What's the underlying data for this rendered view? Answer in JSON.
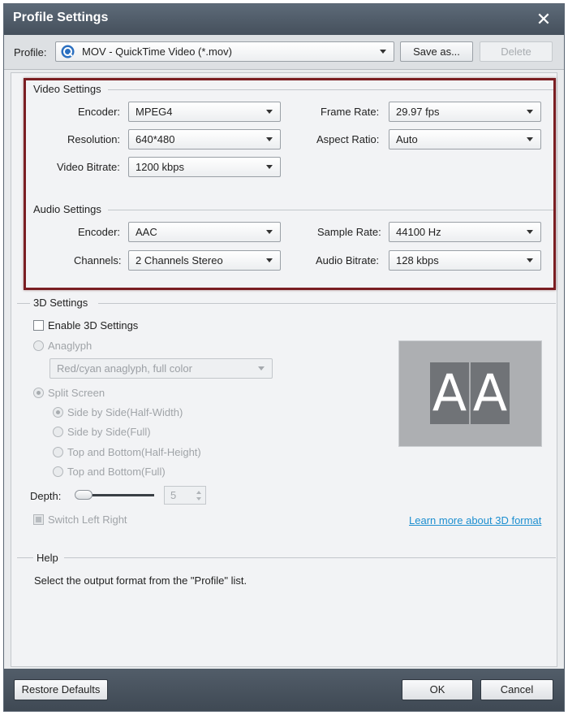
{
  "window": {
    "title": "Profile Settings"
  },
  "profile": {
    "label": "Profile:",
    "selected": "MOV - QuickTime Video (*.mov)",
    "save_as_label": "Save as...",
    "delete_label": "Delete"
  },
  "video": {
    "title": "Video Settings",
    "encoder": {
      "label": "Encoder:",
      "value": "MPEG4"
    },
    "frame_rate": {
      "label": "Frame Rate:",
      "value": "29.97 fps"
    },
    "resolution": {
      "label": "Resolution:",
      "value": "640*480"
    },
    "aspect_ratio": {
      "label": "Aspect Ratio:",
      "value": "Auto"
    },
    "bitrate": {
      "label": "Video Bitrate:",
      "value": "1200 kbps"
    }
  },
  "audio": {
    "title": "Audio Settings",
    "encoder": {
      "label": "Encoder:",
      "value": "AAC"
    },
    "sample_rate": {
      "label": "Sample Rate:",
      "value": "44100 Hz"
    },
    "channels": {
      "label": "Channels:",
      "value": "2 Channels Stereo"
    },
    "bitrate": {
      "label": "Audio Bitrate:",
      "value": "128 kbps"
    }
  },
  "three_d": {
    "title": "3D Settings",
    "enable_label": "Enable 3D Settings",
    "anaglyph_label": "Anaglyph",
    "anaglyph_mode": "Red/cyan anaglyph, full color",
    "split_screen_label": "Split Screen",
    "options": [
      "Side by Side(Half-Width)",
      "Side by Side(Full)",
      "Top and Bottom(Half-Height)",
      "Top and Bottom(Full)"
    ],
    "depth_label": "Depth:",
    "depth_value": "5",
    "switch_label": "Switch Left Right",
    "learn_more": "Learn more about 3D format",
    "preview_left": "A",
    "preview_right": "A"
  },
  "help": {
    "title": "Help",
    "text": "Select the output format from the \"Profile\" list."
  },
  "footer": {
    "restore_label": "Restore Defaults",
    "ok_label": "OK",
    "cancel_label": "Cancel"
  },
  "colors": {
    "highlight_border": "#7a1e22",
    "link": "#1d8fd0",
    "titlebar": "#4f5a66"
  }
}
